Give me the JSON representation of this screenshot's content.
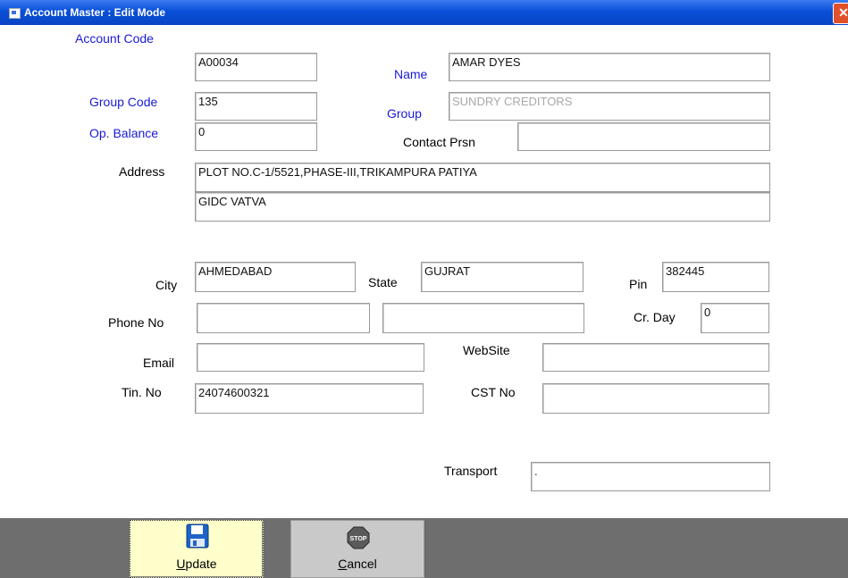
{
  "window": {
    "title": "Account Master : Edit Mode",
    "close_glyph": "✕"
  },
  "labels": {
    "account_code": "Account Code",
    "group_code": "Group Code",
    "op_balance": "Op. Balance",
    "name": "Name",
    "group": "Group",
    "contact_person": "Contact Prsn",
    "address": "Address",
    "city": "City",
    "state": "State",
    "pin": "Pin",
    "phone_no": "Phone No",
    "cr_day": "Cr. Day",
    "email": "Email",
    "website": "WebSite",
    "tin_no": "Tin. No",
    "cst_no": "CST No",
    "transport": "Transport"
  },
  "values": {
    "account_code": "A00034",
    "group_code": "135",
    "op_balance": "0",
    "name": "AMAR DYES",
    "group": "SUNDRY CREDITORS",
    "contact_person": "",
    "address_line1": "PLOT NO.C-1/5521,PHASE-III,TRIKAMPURA PATIYA",
    "address_line2": "GIDC VATVA",
    "city": "AHMEDABAD",
    "state": "GUJRAT",
    "pin": "382445",
    "phone_1": "",
    "phone_2": "",
    "cr_day": "0",
    "email": "",
    "website": "",
    "tin_no": "24074600321",
    "cst_no": "",
    "transport": "."
  },
  "buttons": {
    "update": {
      "accel": "U",
      "rest": "pdate",
      "icon": "floppy-disk-icon"
    },
    "cancel": {
      "accel": "C",
      "rest": "ancel",
      "icon": "stop-sign-icon",
      "icon_text": "STOP"
    }
  },
  "colors": {
    "label_blue": "#1a1ad6",
    "title_bar": "#0a4fd8",
    "update_bg": "#ffffcc",
    "footer": "#6e6e6e"
  }
}
